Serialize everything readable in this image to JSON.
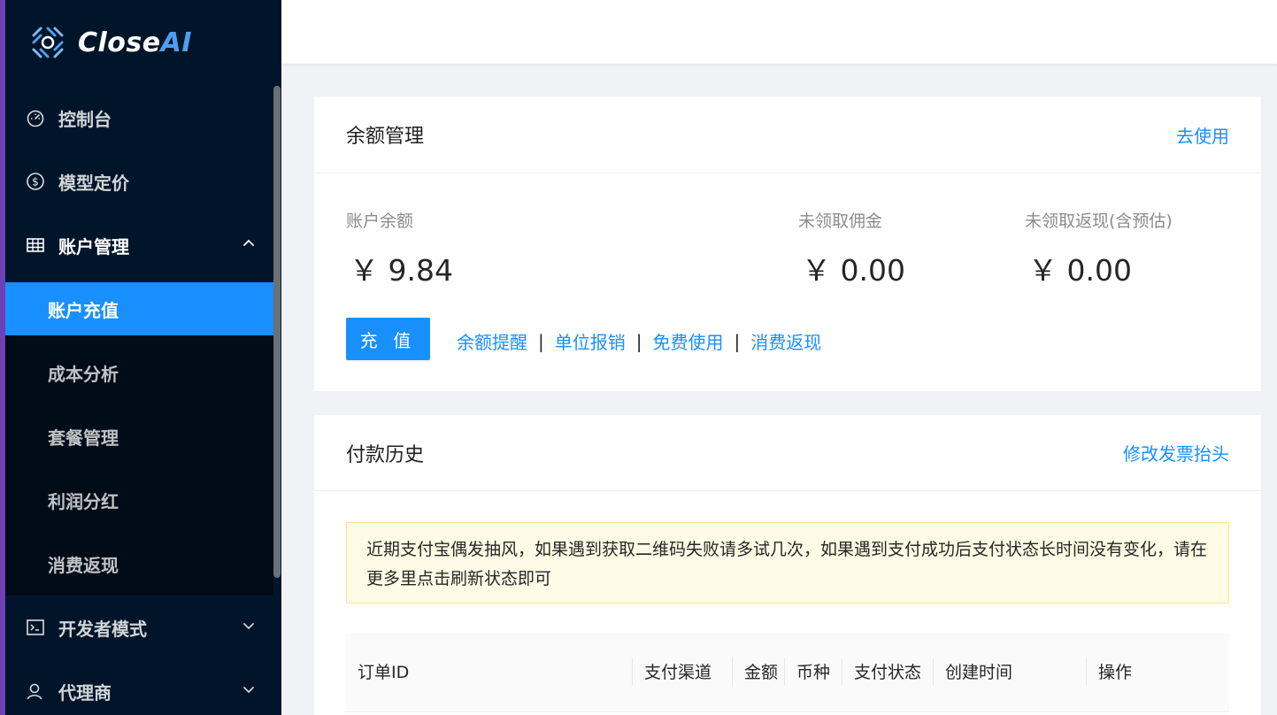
{
  "brand": {
    "name_prefix": "Close",
    "name_suffix": "AI"
  },
  "sidebar": {
    "items": [
      {
        "label": "控制台",
        "icon": "dashboard-icon"
      },
      {
        "label": "模型定价",
        "icon": "dollar-circle-icon"
      },
      {
        "label": "账户管理",
        "icon": "table-icon",
        "expanded": true,
        "children": [
          {
            "label": "账户充值",
            "active": true
          },
          {
            "label": "成本分析"
          },
          {
            "label": "套餐管理"
          },
          {
            "label": "利润分红"
          },
          {
            "label": "消费返现"
          }
        ]
      },
      {
        "label": "开发者模式",
        "icon": "code-icon"
      },
      {
        "label": "代理商",
        "icon": "user-icon"
      }
    ]
  },
  "balance_card": {
    "title": "余额管理",
    "action": "去使用",
    "stats": [
      {
        "label": "账户余额",
        "value": "￥ 9.84"
      },
      {
        "label": "未领取佣金",
        "value": "￥ 0.00"
      },
      {
        "label": "未领取返现(含预估)",
        "value": "￥ 0.00"
      }
    ],
    "recharge_button": "充 值",
    "links": [
      "余额提醒",
      "单位报销",
      "免费使用",
      "消费返现"
    ],
    "separator": "|"
  },
  "history_card": {
    "title": "付款历史",
    "action": "修改发票抬头",
    "notice": "近期支付宝偶发抽风，如果遇到获取二维码失败请多试几次，如果遇到支付成功后支付状态长时间没有变化，请在更多里点击刷新状态即可",
    "columns": [
      "订单ID",
      "支付渠道",
      "金额",
      "币种",
      "支付状态",
      "创建时间",
      "操作"
    ]
  },
  "colors": {
    "primary": "#1890ff",
    "sidebar_bg": "#001529",
    "submenu_bg": "#000c17",
    "notice_bg": "#fffbe6"
  }
}
